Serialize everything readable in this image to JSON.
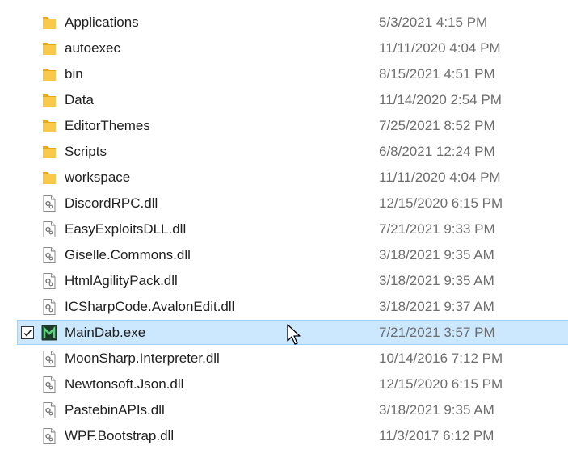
{
  "files": [
    {
      "name": "Applications",
      "date": "5/3/2021 4:15 PM",
      "type": "folder",
      "icon": "folder-icon"
    },
    {
      "name": "autoexec",
      "date": "11/11/2020 4:04 PM",
      "type": "folder",
      "icon": "folder-icon"
    },
    {
      "name": "bin",
      "date": "8/15/2021 4:51 PM",
      "type": "folder",
      "icon": "folder-icon"
    },
    {
      "name": "Data",
      "date": "11/14/2020 2:54 PM",
      "type": "folder",
      "icon": "folder-icon"
    },
    {
      "name": "EditorThemes",
      "date": "7/25/2021 8:52 PM",
      "type": "folder",
      "icon": "folder-icon"
    },
    {
      "name": "Scripts",
      "date": "6/8/2021 12:24 PM",
      "type": "folder",
      "icon": "folder-icon"
    },
    {
      "name": "workspace",
      "date": "11/11/2020 4:04 PM",
      "type": "folder",
      "icon": "folder-icon"
    },
    {
      "name": "DiscordRPC.dll",
      "date": "12/15/2020 6:15 PM",
      "type": "dll",
      "icon": "dll-file-icon"
    },
    {
      "name": "EasyExploitsDLL.dll",
      "date": "7/21/2021 9:33 PM",
      "type": "dll",
      "icon": "dll-file-icon"
    },
    {
      "name": "Giselle.Commons.dll",
      "date": "3/18/2021 9:35 AM",
      "type": "dll",
      "icon": "dll-file-icon"
    },
    {
      "name": "HtmlAgilityPack.dll",
      "date": "3/18/2021 9:35 AM",
      "type": "dll",
      "icon": "dll-file-icon"
    },
    {
      "name": "ICSharpCode.AvalonEdit.dll",
      "date": "3/18/2021 9:37 AM",
      "type": "dll",
      "icon": "dll-file-icon"
    },
    {
      "name": "MainDab.exe",
      "date": "7/21/2021 3:57 PM",
      "type": "exe",
      "icon": "maindab-app-icon",
      "selected": true,
      "checked": true
    },
    {
      "name": "MoonSharp.Interpreter.dll",
      "date": "10/14/2016 7:12 PM",
      "type": "dll",
      "icon": "dll-file-icon"
    },
    {
      "name": "Newtonsoft.Json.dll",
      "date": "12/15/2020 6:15 PM",
      "type": "dll",
      "icon": "dll-file-icon"
    },
    {
      "name": "PastebinAPIs.dll",
      "date": "3/18/2021 9:35 AM",
      "type": "dll",
      "icon": "dll-file-icon"
    },
    {
      "name": "WPF.Bootstrap.dll",
      "date": "11/3/2017 6:12 PM",
      "type": "dll",
      "icon": "dll-file-icon"
    }
  ],
  "colors": {
    "selection_bg": "#cce8ff",
    "selection_border": "#99d1ff",
    "folder": "#f8c94a",
    "date_text": "#6d6d6d",
    "exe_icon_bg": "#1e3a2a",
    "exe_icon_fg": "#5ad17a"
  }
}
